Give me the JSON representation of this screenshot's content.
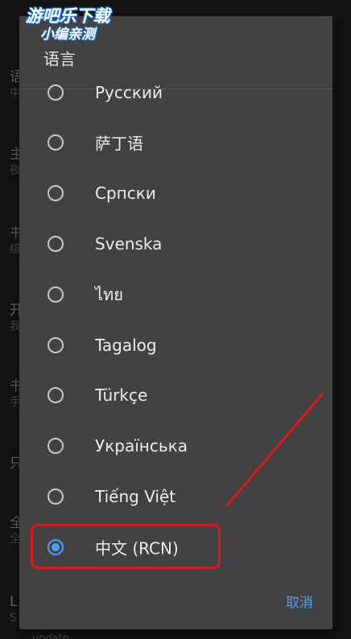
{
  "watermark": {
    "line1": "游吧乐下载",
    "line2": "小编亲测"
  },
  "background": {
    "items": [
      {
        "title": "语",
        "subtitle": "中"
      },
      {
        "title": "主",
        "subtitle": "夜"
      },
      {
        "title": "书",
        "subtitle": "级"
      },
      {
        "title": "开",
        "subtitle": "我"
      },
      {
        "title": "书",
        "subtitle": "手"
      },
      {
        "title": "只",
        "subtitle": ""
      },
      {
        "title": "全",
        "subtitle": "全"
      },
      {
        "title": "L",
        "subtitle": "S"
      }
    ],
    "footer_partial": "update"
  },
  "dialog": {
    "title": "语言",
    "options": [
      {
        "label": "Русский",
        "selected": false
      },
      {
        "label": "萨丁语",
        "selected": false
      },
      {
        "label": "Српски",
        "selected": false
      },
      {
        "label": "Svenska",
        "selected": false
      },
      {
        "label": "ไทย",
        "selected": false
      },
      {
        "label": "Tagalog",
        "selected": false
      },
      {
        "label": "Türkçe",
        "selected": false
      },
      {
        "label": "Українська",
        "selected": false
      },
      {
        "label": "Tiếng Việt",
        "selected": false
      },
      {
        "label": "中文 (RCN)",
        "selected": true
      }
    ],
    "cancel_label": "取消"
  },
  "colors": {
    "accent": "#4d9ff5",
    "dialog_bg": "#424242",
    "annotation": "#e11818"
  }
}
